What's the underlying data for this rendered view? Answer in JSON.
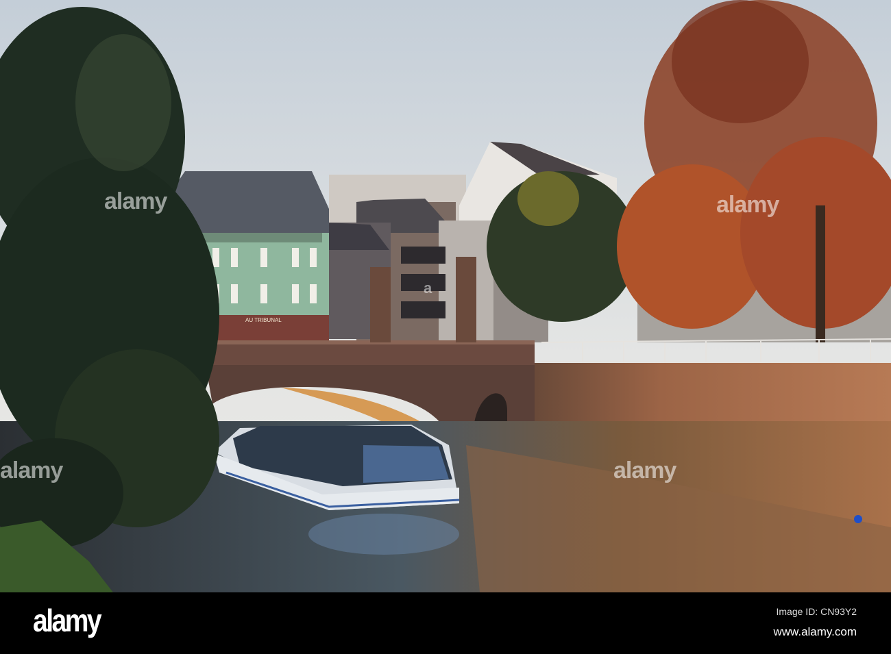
{
  "photo": {
    "description_alt": "",
    "sign_text": "AU TRIBUNAL",
    "watermarks": [
      "alamy",
      "alamy",
      "alamy",
      "alamy",
      "a"
    ]
  },
  "footer": {
    "logo": "alamy",
    "image_id": "Image ID: CN93Y2",
    "website": "www.alamy.com"
  }
}
